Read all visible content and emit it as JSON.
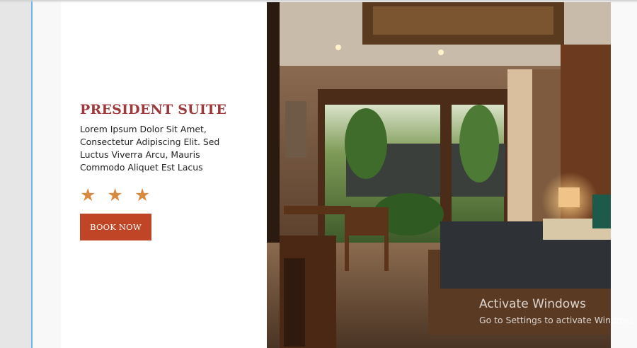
{
  "room": {
    "title": "PRESIDENT SUITE",
    "description": "Lorem Ipsum Dolor Sit Amet, Consectetur Adipiscing Elit. Sed Luctus Viverra Arcu, Mauris Commodo Aliquet Est Lacus",
    "rating": 3,
    "stars": [
      "★",
      "★",
      "★"
    ],
    "book_label": "BOOK NOW",
    "photo_alt": "hotel room photo"
  },
  "watermark": {
    "title": "Activate Windows",
    "subtitle": "Go to Settings to activate Windows."
  },
  "colors": {
    "title": "#9e3a3c",
    "star": "#d88a3f",
    "button": "#bf4526",
    "accent_edge": "#6fb3f2"
  }
}
